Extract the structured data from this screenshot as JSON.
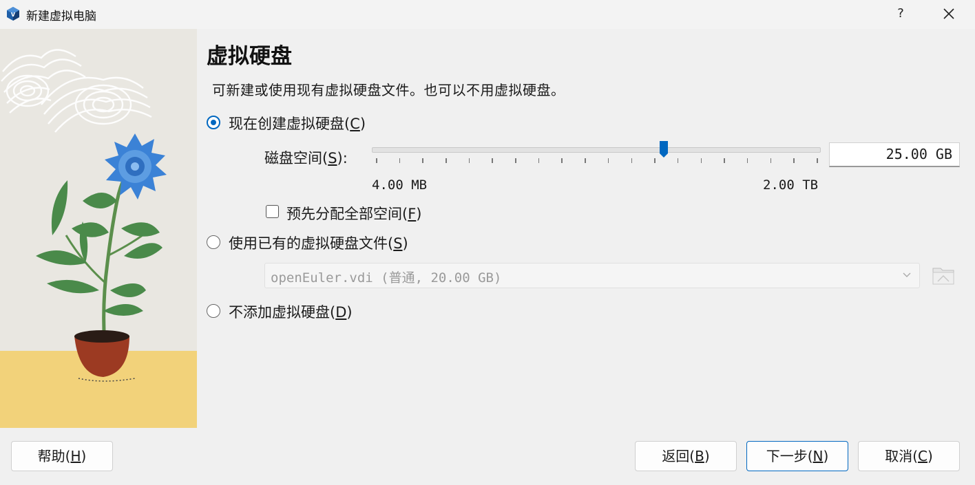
{
  "window": {
    "title": "新建虚拟电脑",
    "help_glyph": "?"
  },
  "page": {
    "heading": "虚拟硬盘",
    "description": "可新建或使用现有虚拟硬盘文件。也可以不用虚拟硬盘。"
  },
  "options": {
    "create_new": {
      "label": "现在创建虚拟硬盘(",
      "key": "C",
      "suffix": ")",
      "selected": true
    },
    "use_existing": {
      "label": "使用已有的虚拟硬盘文件(",
      "key": "S",
      "suffix": ")",
      "selected": false
    },
    "no_disk": {
      "label": "不添加虚拟硬盘(",
      "key": "D",
      "suffix": ")",
      "selected": false
    }
  },
  "disk_size": {
    "label": "磁盘空间(",
    "key": "S",
    "suffix": "):",
    "value": "25.00 GB",
    "min_label": "4.00 MB",
    "max_label": "2.00 TB",
    "slider_fraction": 0.65
  },
  "prealloc": {
    "label": "预先分配全部空间(",
    "key": "F",
    "suffix": ")",
    "checked": false
  },
  "existing_file": {
    "value": "openEuler.vdi (普通, 20.00 GB)"
  },
  "buttons": {
    "help": {
      "label": "帮助(",
      "key": "H",
      "suffix": ")"
    },
    "back": {
      "label": "返回(",
      "key": "B",
      "suffix": ")"
    },
    "next": {
      "label": "下一步(",
      "key": "N",
      "suffix": ")"
    },
    "cancel": {
      "label": "取消(",
      "key": "C",
      "suffix": ")"
    }
  },
  "colors": {
    "accent": "#0067c0",
    "side_yellow": "#f2d27a",
    "flower_blue": "#3b82d6",
    "leaf_green": "#4a8a4a",
    "pot_red": "#9c3a22"
  }
}
